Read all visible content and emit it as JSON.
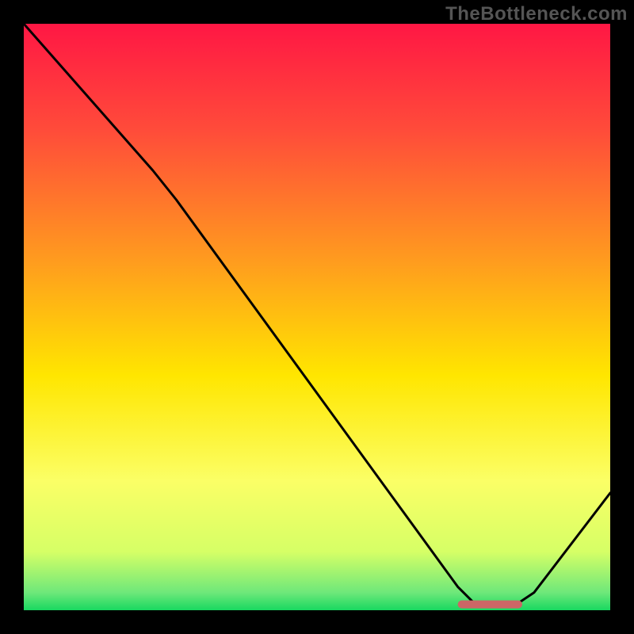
{
  "watermark": "TheBottleneck.com",
  "chart_data": {
    "type": "line",
    "title": "",
    "xlabel": "",
    "ylabel": "",
    "xlim": [
      0,
      100
    ],
    "ylim": [
      0,
      100
    ],
    "gradient_stops": [
      {
        "offset": 0,
        "color": "#ff1744"
      },
      {
        "offset": 18,
        "color": "#ff4b3a"
      },
      {
        "offset": 40,
        "color": "#ff9a1f"
      },
      {
        "offset": 60,
        "color": "#ffe600"
      },
      {
        "offset": 78,
        "color": "#fbff66"
      },
      {
        "offset": 90,
        "color": "#d6ff66"
      },
      {
        "offset": 97,
        "color": "#6ee87a"
      },
      {
        "offset": 100,
        "color": "#18d860"
      }
    ],
    "curve": [
      {
        "x": 0,
        "y": 100
      },
      {
        "x": 22,
        "y": 75
      },
      {
        "x": 26,
        "y": 70
      },
      {
        "x": 74,
        "y": 4
      },
      {
        "x": 77,
        "y": 1
      },
      {
        "x": 84,
        "y": 1
      },
      {
        "x": 87,
        "y": 3
      },
      {
        "x": 100,
        "y": 20
      }
    ],
    "marker": {
      "x_start": 74,
      "x_end": 85,
      "y": 1,
      "color": "#cc6666"
    }
  }
}
